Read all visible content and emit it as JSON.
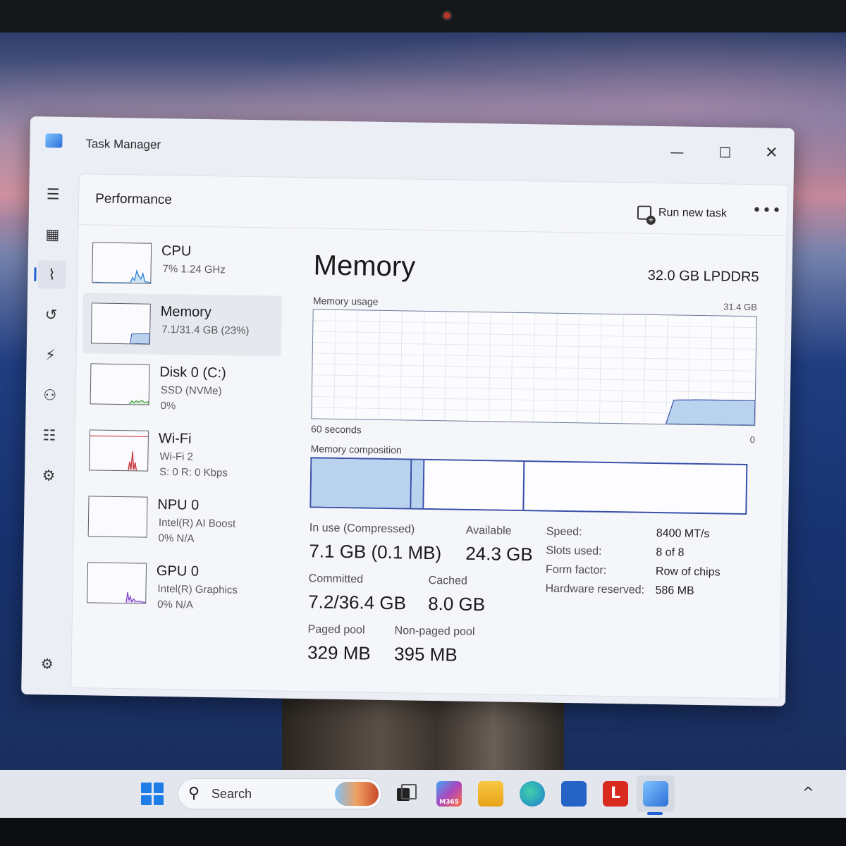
{
  "window": {
    "title": "Task Manager"
  },
  "nav": {
    "items": [
      {
        "name": "menu-icon",
        "glyph": "☰"
      },
      {
        "name": "processes-icon",
        "glyph": "▦"
      },
      {
        "name": "performance-icon",
        "glyph": "⌇"
      },
      {
        "name": "app-history-icon",
        "glyph": "↺"
      },
      {
        "name": "startup-apps-icon",
        "glyph": "⚡"
      },
      {
        "name": "users-icon",
        "glyph": "⚇"
      },
      {
        "name": "details-icon",
        "glyph": "☷"
      },
      {
        "name": "services-icon",
        "glyph": "⚙"
      }
    ],
    "settings_glyph": "⚙"
  },
  "header": {
    "page_title": "Performance",
    "run_new_task_label": "Run new task",
    "more_glyph": "•••"
  },
  "resources": [
    {
      "name": "CPU",
      "sub1": "7% 1.24 GHz",
      "sub2": ""
    },
    {
      "name": "Memory",
      "sub1": "7.1/31.4 GB (23%)",
      "sub2": ""
    },
    {
      "name": "Disk 0 (C:)",
      "sub1": "SSD (NVMe)",
      "sub2": "0%"
    },
    {
      "name": "Wi-Fi",
      "sub1": "Wi-Fi 2",
      "sub2": "S: 0 R: 0 Kbps"
    },
    {
      "name": "NPU 0",
      "sub1": "Intel(R) AI Boost",
      "sub2": "0% N/A"
    },
    {
      "name": "GPU 0",
      "sub1": "Intel(R) Graphics",
      "sub2": "0% N/A"
    }
  ],
  "detail": {
    "title": "Memory",
    "spec": "32.0 GB LPDDR5",
    "usage_label": "Memory usage",
    "usage_max": "31.4 GB",
    "usage_time": "60 seconds",
    "usage_min": "0",
    "composition_label": "Memory composition",
    "usage_history_gb": [
      0,
      0,
      0,
      0,
      0,
      0,
      0,
      0,
      0,
      0,
      0,
      0,
      0,
      0,
      0,
      0,
      0,
      0,
      0,
      0,
      0,
      0,
      0,
      0,
      0,
      0,
      0,
      0,
      0,
      0,
      0,
      0,
      0,
      0,
      0,
      0,
      0,
      0,
      0,
      0,
      0,
      0,
      0,
      0,
      0,
      0,
      0,
      0,
      0,
      6.9,
      7.0,
      7.0,
      7.1,
      7.1,
      7.1,
      7.1,
      7.1,
      7.1,
      7.1,
      7.1,
      7.1
    ],
    "usage_total_gb": 31.4,
    "composition_fractions": {
      "in_use": 0.23,
      "modified": 0.03,
      "standby": 0.23
    },
    "stats": {
      "in_use_label": "In use (Compressed)",
      "in_use_value": "7.1 GB (0.1 MB)",
      "available_label": "Available",
      "available_value": "24.3 GB",
      "committed_label": "Committed",
      "committed_value": "7.2/36.4 GB",
      "cached_label": "Cached",
      "cached_value": "8.0 GB",
      "paged_label": "Paged pool",
      "paged_value": "329 MB",
      "nonpaged_label": "Non-paged pool",
      "nonpaged_value": "395 MB"
    },
    "specs": {
      "speed_label": "Speed:",
      "speed_value": "8400 MT/s",
      "slots_label": "Slots used:",
      "slots_value": "8 of 8",
      "form_label": "Form factor:",
      "form_value": "Row of chips",
      "reserved_label": "Hardware reserved:",
      "reserved_value": "586 MB"
    }
  },
  "taskbar": {
    "search_placeholder": "Search",
    "search_glyph": "⚲",
    "m365_label": "M365",
    "l_label": "L",
    "chevron": "^"
  },
  "colors": {
    "memory_fill": "#b9d3ef",
    "memory_line": "#3a4fa8",
    "cpu_line": "#2a7fd6",
    "disk_line": "#3c9a3c",
    "wifi_line": "#c0262e",
    "gpu_line": "#7b3fc6",
    "accent": "#1d5fd2"
  }
}
